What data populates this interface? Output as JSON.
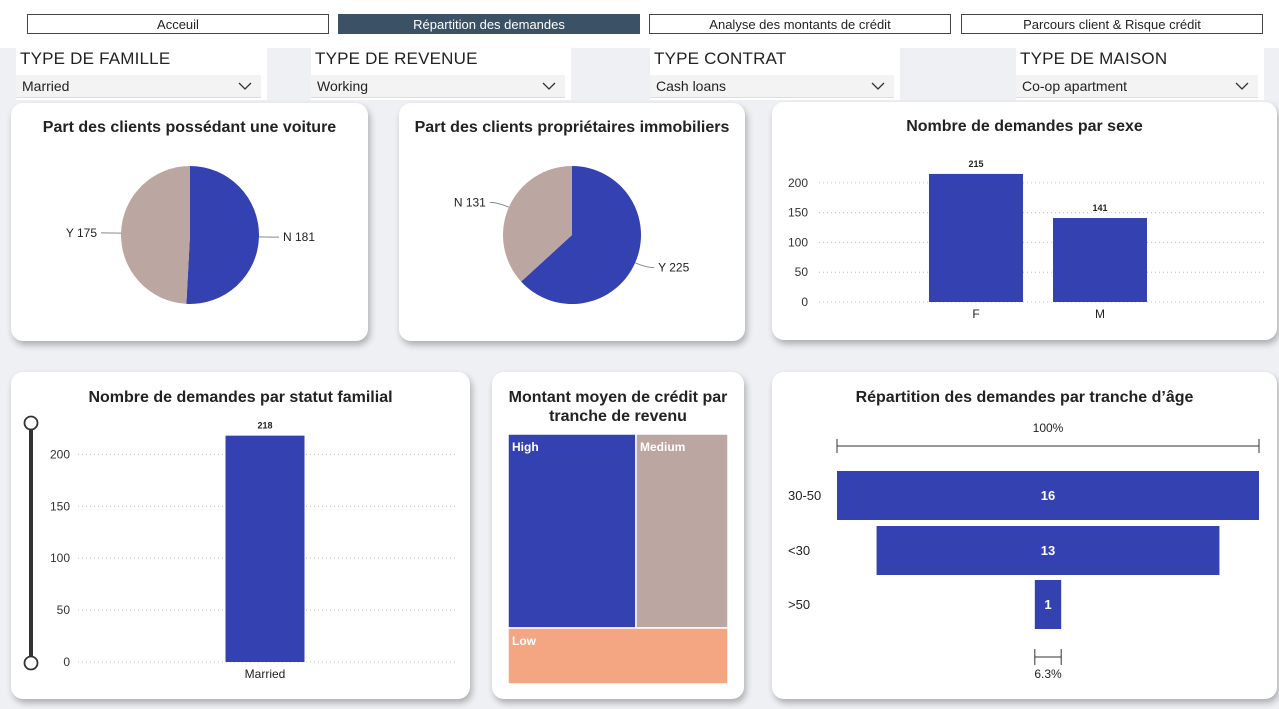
{
  "nav": {
    "buttons": [
      {
        "label": "Acceuil",
        "active": false
      },
      {
        "label": "Répartition des demandes",
        "active": true
      },
      {
        "label": "Analyse des montants de crédit",
        "active": false
      },
      {
        "label": "Parcours client & Risque crédit",
        "active": false
      }
    ]
  },
  "filters": [
    {
      "label": "TYPE DE FAMILLE",
      "value": "Married"
    },
    {
      "label": "TYPE DE REVENUE",
      "value": "Working"
    },
    {
      "label": "TYPE CONTRAT",
      "value": "Cash loans"
    },
    {
      "label": "TYPE DE MAISON",
      "value": "Co-op apartment"
    }
  ],
  "colors": {
    "primary": "#3441b0",
    "secondary": "#bba6a2",
    "accent": "#f4a582",
    "nav_active": "#3a5166"
  },
  "chart_data": [
    {
      "type": "pie",
      "title": "Part des clients possédant une voiture",
      "slices": [
        {
          "label": "N",
          "value": 181
        },
        {
          "label": "Y",
          "value": 175
        }
      ]
    },
    {
      "type": "pie",
      "title": "Part des clients propriétaires immobiliers",
      "slices": [
        {
          "label": "Y",
          "value": 225
        },
        {
          "label": "N",
          "value": 131
        }
      ]
    },
    {
      "type": "bar",
      "title": "Nombre de demandes par sexe",
      "categories": [
        "F",
        "M"
      ],
      "values": [
        215,
        141
      ],
      "ylim": [
        0,
        230
      ],
      "yticks": [
        0,
        50,
        100,
        150,
        200
      ],
      "grid": true
    },
    {
      "type": "bar",
      "title": "Nombre de demandes par statut familial",
      "categories": [
        "Married"
      ],
      "values": [
        218
      ],
      "ylim": [
        0,
        235
      ],
      "yticks": [
        0,
        50,
        100,
        150,
        200
      ],
      "grid": true
    },
    {
      "type": "treemap",
      "title": "Montant moyen de crédit par tranche de revenu",
      "items": [
        {
          "label": "High"
        },
        {
          "label": "Medium"
        },
        {
          "label": "Low"
        }
      ]
    },
    {
      "type": "funnel",
      "title": "Répartition des demandes par tranche d’âge",
      "categories": [
        "30-50",
        "<30",
        ">50"
      ],
      "values": [
        16,
        13,
        1
      ],
      "top_label": "100%",
      "bottom_label": "6.3%"
    }
  ]
}
